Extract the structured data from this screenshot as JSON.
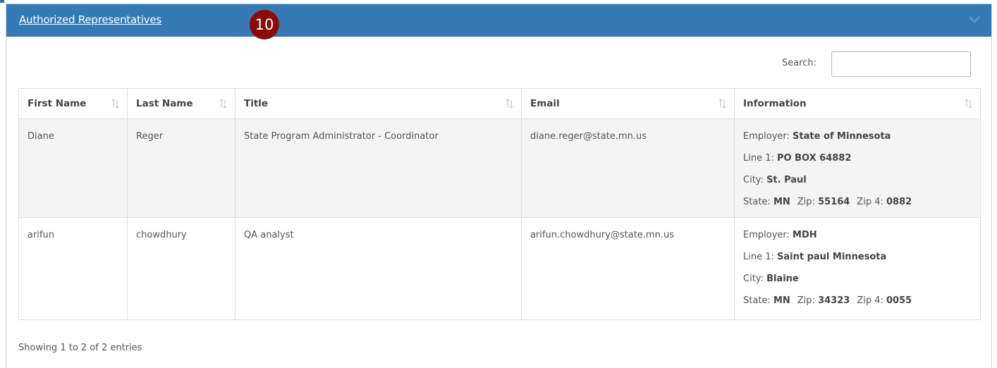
{
  "panel": {
    "title": "Authorized Representatives",
    "step_number": "10",
    "collapse_icon": "chevron-down-icon"
  },
  "search": {
    "label": "Search:",
    "value": "",
    "placeholder": ""
  },
  "table": {
    "columns": [
      "First Name",
      "Last Name",
      "Title",
      "Email",
      "Information"
    ],
    "sort_icon": "sort-both-icon",
    "rows": [
      {
        "first_name": "Diane",
        "last_name": "Reger",
        "title": "State Program Administrator - Coordinator",
        "email": "diane.reger@state.mn.us",
        "info": {
          "employer_label": "Employer:",
          "employer": "State of Minnesota",
          "line1_label": "Line 1:",
          "line1": "PO BOX 64882",
          "city_label": "City:",
          "city": "St. Paul",
          "state_label": "State:",
          "state": "MN",
          "zip_label": "Zip:",
          "zip": "55164",
          "zip4_label": "Zip 4:",
          "zip4": "0882"
        }
      },
      {
        "first_name": "arifun",
        "last_name": "chowdhury",
        "title": "QA analyst",
        "email": "arifun.chowdhury@state.mn.us",
        "info": {
          "employer_label": "Employer:",
          "employer": "MDH",
          "line1_label": "Line 1:",
          "line1": "Saint paul Minnesota",
          "city_label": "City:",
          "city": "Blaine",
          "state_label": "State:",
          "state": "MN",
          "zip_label": "Zip:",
          "zip": "34323",
          "zip4_label": "Zip 4:",
          "zip4": "0055"
        }
      }
    ]
  },
  "footer": {
    "info": "Showing 1 to 2 of 2 entries"
  },
  "colors": {
    "header_bg": "#3579b5",
    "badge_bg": "#8a0a0a",
    "row_stripe": "#f4f4f4"
  }
}
